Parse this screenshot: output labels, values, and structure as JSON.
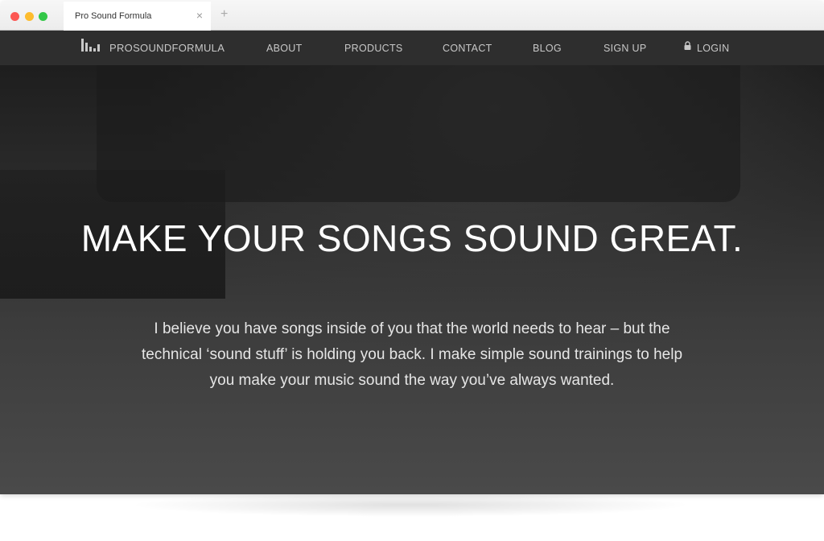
{
  "browser": {
    "tab_title": "Pro Sound Formula",
    "close": "×",
    "new_tab": "+"
  },
  "nav": {
    "logo": "PROSOUNDFORMULA",
    "items": [
      "ABOUT",
      "PRODUCTS",
      "CONTACT",
      "BLOG",
      "SIGN UP"
    ],
    "login": "LOGIN",
    "login_icon": "lock-icon"
  },
  "hero": {
    "title": "MAKE YOUR SONGS SOUND GREAT.",
    "text": "I believe you have songs inside of you that the world needs to hear – but the technical ‘sound stuff’ is holding you back. I make simple sound trainings to help you make your music sound the way you’ve always wanted."
  }
}
